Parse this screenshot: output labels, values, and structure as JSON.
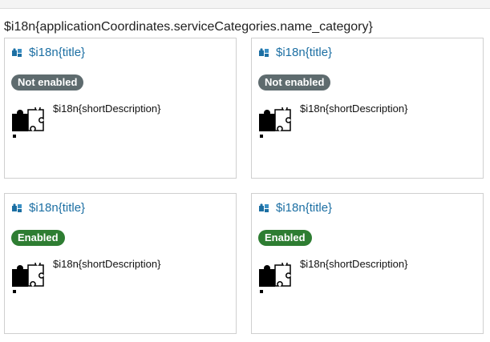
{
  "category": {
    "heading": "$i18n{applicationCoordinates.serviceCategories.name_category}"
  },
  "cards": [
    {
      "title": "$i18n{title}",
      "status": "Not enabled",
      "description": "$i18n{shortDescription}",
      "title_icon": "plugin-icon",
      "main_icon": "puzzle-icon"
    },
    {
      "title": "$i18n{title}",
      "status": "Not enabled",
      "description": "$i18n{shortDescription}",
      "title_icon": "plugin-icon",
      "main_icon": "puzzle-icon"
    },
    {
      "title": "$i18n{title}",
      "status": "Enabled",
      "description": "$i18n{shortDescription}",
      "title_icon": "plugin-icon",
      "main_icon": "puzzle-icon"
    },
    {
      "title": "$i18n{title}",
      "status": "Enabled",
      "description": "$i18n{shortDescription}",
      "title_icon": "plugin-icon",
      "main_icon": "puzzle-icon"
    }
  ],
  "colors": {
    "title_link": "#1c6fa3",
    "badge_not_enabled": "#5e6b6e",
    "badge_enabled": "#2e7d32"
  }
}
